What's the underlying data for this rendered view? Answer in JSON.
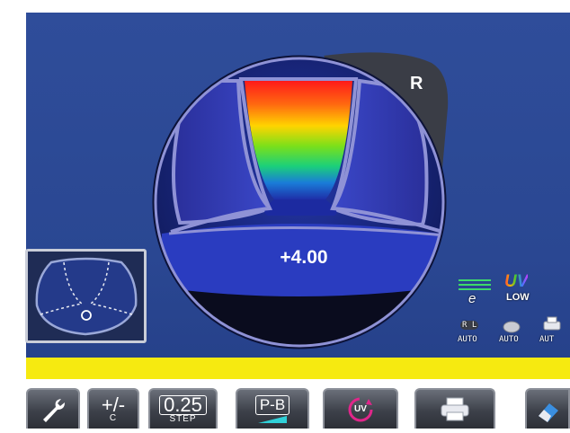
{
  "lens": {
    "eye_label": "R",
    "power_reading": "+4.00"
  },
  "indicators": {
    "e_label": "e",
    "uv_label": "UV",
    "uv_level": "LOW",
    "auto_rl_top": "R L",
    "auto_rl_bottom": "AUTO",
    "auto_center": "AUTO",
    "auto_right": "AUT"
  },
  "toolbar": {
    "tools_icon": "wrench-icon",
    "sign_label": "+/-",
    "sign_sub": "C",
    "step_value": "0.25",
    "step_label": "STEP",
    "pb_label": "P-B",
    "uv_button": "UV",
    "print_icon": "printer-icon",
    "eraser_icon": "eraser-icon"
  },
  "colors": {
    "panel_blue": "#2f4d9a",
    "status_yellow": "#f6ea10",
    "lens_outline": "#8f92d6"
  }
}
